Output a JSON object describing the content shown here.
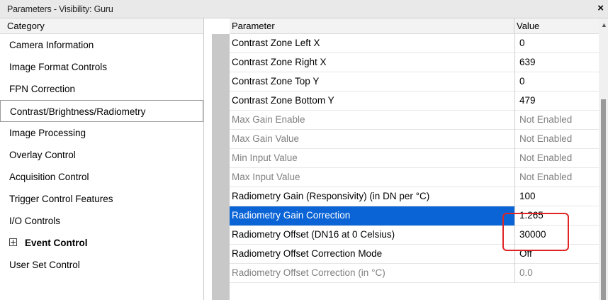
{
  "window": {
    "title": "Parameters - Visibility: Guru",
    "close_glyph": "×"
  },
  "category_panel": {
    "header": "Category",
    "items": [
      {
        "label": "Camera Information"
      },
      {
        "label": "Image Format Controls"
      },
      {
        "label": "FPN Correction"
      },
      {
        "label": "Contrast/Brightness/Radiometry",
        "selected": true
      },
      {
        "label": "Image Processing"
      },
      {
        "label": "Overlay Control"
      },
      {
        "label": "Acquisition Control"
      },
      {
        "label": "Trigger Control Features"
      },
      {
        "label": "I/O Controls"
      },
      {
        "label": "Event Control",
        "expandable": true
      },
      {
        "label": "User Set Control"
      }
    ]
  },
  "parameter_panel": {
    "header_parameter": "Parameter",
    "header_value": "Value",
    "rows": [
      {
        "name": "Contrast Zone Left X",
        "value": "0",
        "enabled": true
      },
      {
        "name": "Contrast Zone Right X",
        "value": "639",
        "enabled": true
      },
      {
        "name": "Contrast Zone Top Y",
        "value": "0",
        "enabled": true
      },
      {
        "name": "Contrast Zone Bottom Y",
        "value": "479",
        "enabled": true
      },
      {
        "name": "Max Gain Enable",
        "value": "Not Enabled",
        "enabled": false
      },
      {
        "name": "Max Gain Value",
        "value": "Not Enabled",
        "enabled": false
      },
      {
        "name": "Min Input Value",
        "value": "Not Enabled",
        "enabled": false
      },
      {
        "name": "Max Input Value",
        "value": "Not Enabled",
        "enabled": false
      },
      {
        "name": "Radiometry Gain (Responsivity) (in DN per °C)",
        "value": "100",
        "enabled": true
      },
      {
        "name": "Radiometry Gain Correction",
        "value": "1.265",
        "enabled": true,
        "selected": true
      },
      {
        "name": "Radiometry Offset (DN16 at 0 Celsius)",
        "value": "30000",
        "enabled": true
      },
      {
        "name": "Radiometry Offset Correction Mode",
        "value": "Off",
        "enabled": true
      },
      {
        "name": "Radiometry Offset Correction (in °C)",
        "value": "0.0",
        "enabled": false
      }
    ]
  },
  "colors": {
    "selection": "#0a64d6",
    "annotation": "#e02424",
    "disabled_text": "#808080"
  }
}
